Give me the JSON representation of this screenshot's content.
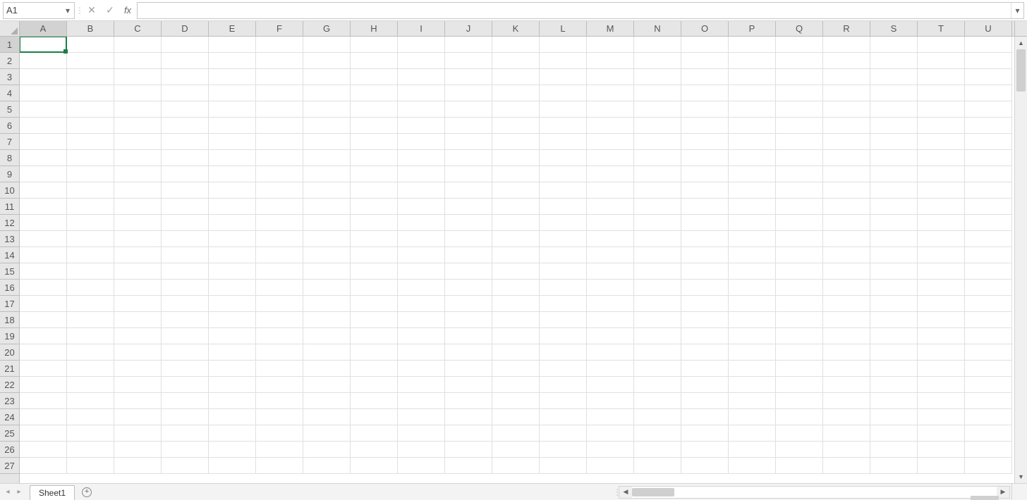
{
  "formula_bar": {
    "name_box_value": "A1",
    "cancel_icon": "✕",
    "enter_icon": "✓",
    "fx_label": "fx",
    "formula_value": "",
    "expand_icon": "▾"
  },
  "grid": {
    "columns": [
      "A",
      "B",
      "C",
      "D",
      "E",
      "F",
      "G",
      "H",
      "I",
      "J",
      "K",
      "L",
      "M",
      "N",
      "O",
      "P",
      "Q",
      "R",
      "S",
      "T",
      "U"
    ],
    "rows": [
      "1",
      "2",
      "3",
      "4",
      "5",
      "6",
      "7",
      "8",
      "9",
      "10",
      "11",
      "12",
      "13",
      "14",
      "15",
      "16",
      "17",
      "18",
      "19",
      "20",
      "21",
      "22",
      "23",
      "24",
      "25",
      "26",
      "27"
    ],
    "selected_column": "A",
    "selected_row": "1",
    "active_cell": "A1"
  },
  "sheets": {
    "nav_prev": "◂",
    "nav_next": "▸",
    "tabs": [
      "Sheet1"
    ],
    "add_label": "+"
  },
  "colors": {
    "selection_border": "#1a7f47",
    "header_bg": "#e6e6e6",
    "grid_line": "#e0e0e0"
  }
}
